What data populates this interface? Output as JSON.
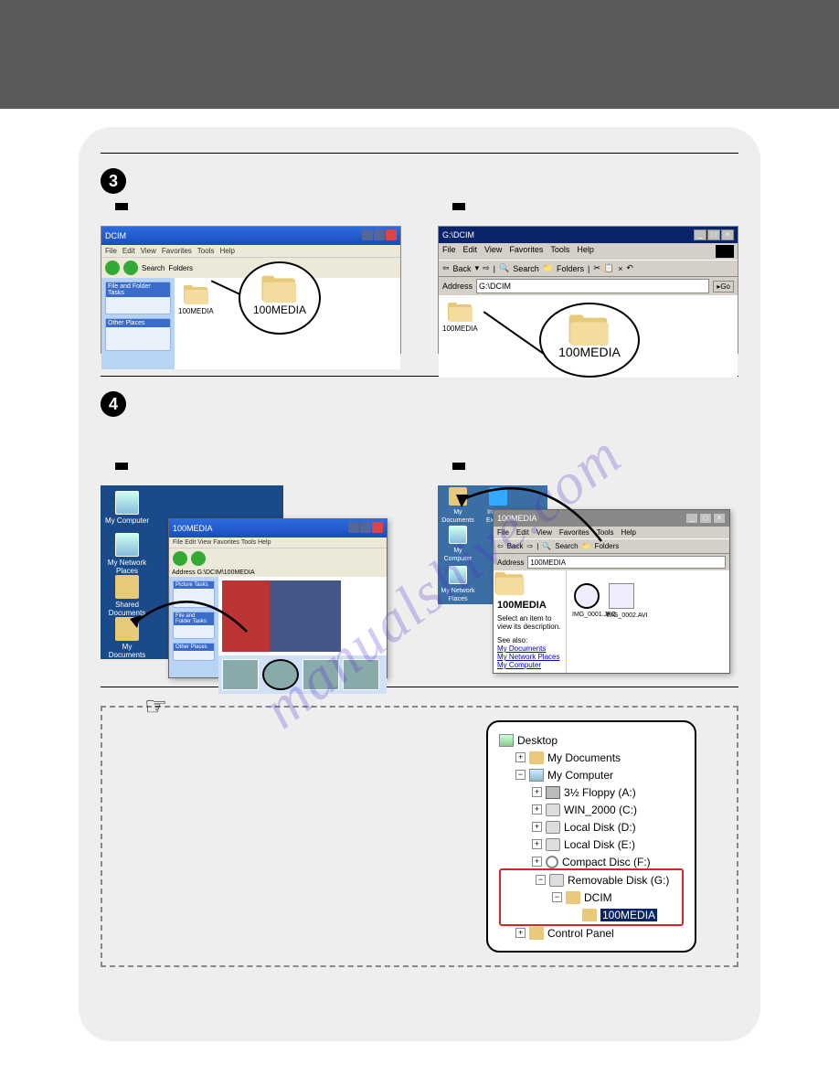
{
  "watermark": "manualshive.com",
  "steps": {
    "s3": "3",
    "s4": "4"
  },
  "shot1": {
    "title": "DCIM",
    "menu": [
      "File",
      "Edit",
      "View",
      "Favorites",
      "Tools",
      "Help"
    ],
    "toolbar": [
      "Back",
      "",
      "",
      "Search",
      "Folders"
    ],
    "side_panels": [
      "File and Folder Tasks",
      "Other Places"
    ],
    "folder_small": "100MEDIA",
    "callout": "100MEDIA"
  },
  "shot2": {
    "title": "G:\\DCIM",
    "menu": [
      "File",
      "Edit",
      "View",
      "Favorites",
      "Tools",
      "Help"
    ],
    "tb": [
      "Back",
      "",
      "",
      "Search",
      "Folders",
      "",
      "",
      ""
    ],
    "addr_label": "Address",
    "addr_value": "G:\\DCIM",
    "go": "Go",
    "folder_small": "100MEDIA",
    "callout": "100MEDIA"
  },
  "desktop_xp": {
    "icons": [
      "My Computer",
      "My Network Places",
      "Shared Documents",
      "My Documents"
    ],
    "win_title": "100MEDIA",
    "addr": "Address G:\\DCIM\\100MEDIA"
  },
  "desktop_2k": {
    "icons": [
      "My Documents",
      "Internet Explorer",
      "My Computer",
      "My Network Places"
    ],
    "win_title": "100MEDIA",
    "menu": [
      "File",
      "Edit",
      "View",
      "Favorites",
      "Tools",
      "Help"
    ],
    "tb": [
      "Back",
      "",
      "",
      "Search",
      "Folders"
    ],
    "addr_label": "Address",
    "addr_value": "100MEDIA",
    "body_label": "100MEDIA",
    "hint": "Select an item to view its description.",
    "seealso": "See also:",
    "links": [
      "My Documents",
      "My Network Places",
      "My Computer"
    ],
    "files": [
      "IMG_0001.JPG",
      "IMG_0002.AVI"
    ]
  },
  "tree": {
    "desktop": "Desktop",
    "mydocs": "My Documents",
    "mycomp": "My Computer",
    "floppy": "3½ Floppy (A:)",
    "c": "WIN_2000 (C:)",
    "d": "Local Disk (D:)",
    "e": "Local Disk (E:)",
    "f": "Compact Disc (F:)",
    "g": "Removable Disk (G:)",
    "dcim": "DCIM",
    "media": "100MEDIA",
    "ctrl": "Control Panel"
  }
}
